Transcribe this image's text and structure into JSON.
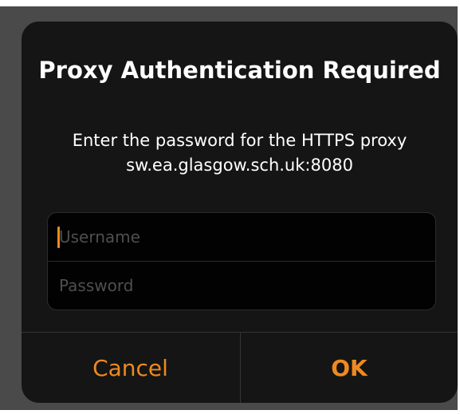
{
  "dialog": {
    "title": "Proxy Authentication Required",
    "message": "Enter the password for the HTTPS proxy sw.ea.glasgow.sch.uk:8080",
    "username_placeholder": "Username",
    "password_placeholder": "Password",
    "cancel_label": "Cancel",
    "ok_label": "OK"
  },
  "colors": {
    "accent": "#ee8a1f",
    "dialog_background": "#151515",
    "field_background": "#020202",
    "placeholder": "#4f4f4f",
    "text": "#ffffff"
  }
}
